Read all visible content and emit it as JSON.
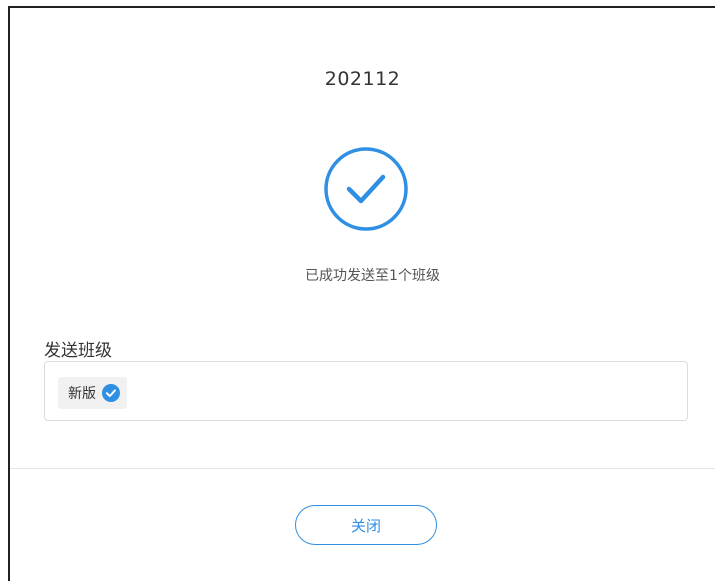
{
  "dialog": {
    "title": "202112",
    "success_icon": "check-circle-icon",
    "success_message": "已成功发送至1个班级",
    "section_label": "发送班级",
    "classes": [
      {
        "name": "新版",
        "icon": "check-badge-icon"
      }
    ],
    "close_label": "关闭"
  },
  "colors": {
    "accent": "#2f8fe3",
    "text": "#333333",
    "border": "#dcdcdc",
    "chip_bg": "#f1f1f1"
  }
}
